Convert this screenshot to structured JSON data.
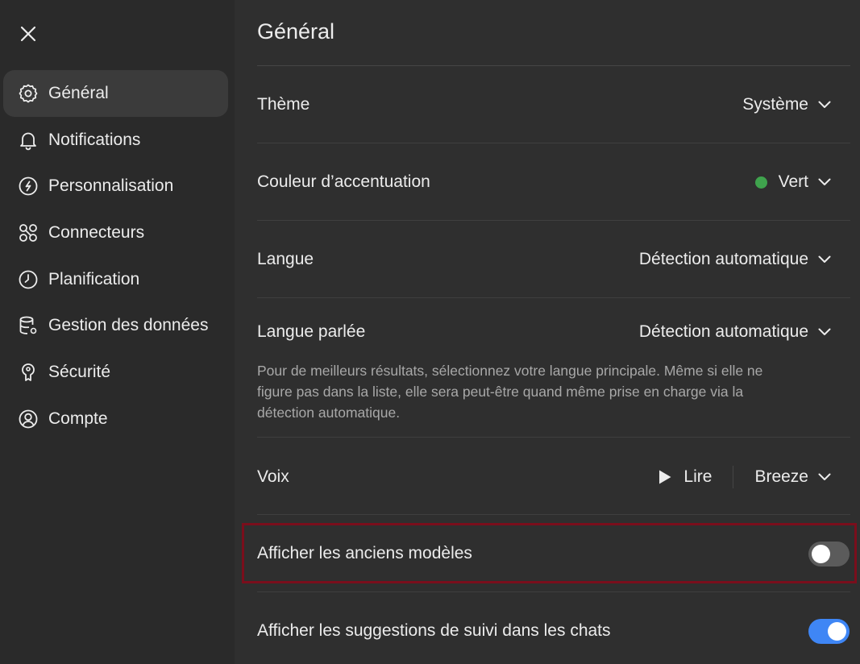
{
  "sidebar": {
    "close_icon": "close-icon",
    "items": [
      {
        "label": "Général",
        "icon": "gear-icon",
        "active": true
      },
      {
        "label": "Notifications",
        "icon": "bell-icon"
      },
      {
        "label": "Personnalisation",
        "icon": "personalization-icon"
      },
      {
        "label": "Connecteurs",
        "icon": "connectors-icon"
      },
      {
        "label": "Planification",
        "icon": "clock-icon"
      },
      {
        "label": "Gestion des données",
        "icon": "database-icon"
      },
      {
        "label": "Sécurité",
        "icon": "key-icon"
      },
      {
        "label": "Compte",
        "icon": "user-circle-icon"
      }
    ]
  },
  "main": {
    "title": "Général",
    "theme": {
      "label": "Thème",
      "value": "Système"
    },
    "accent": {
      "label": "Couleur d’accentuation",
      "value": "Vert",
      "color": "#3fa34d"
    },
    "language": {
      "label": "Langue",
      "value": "Détection automatique"
    },
    "spoken_language": {
      "label": "Langue parlée",
      "value": "Détection automatique",
      "description": "Pour de meilleurs résultats, sélectionnez votre langue principale. Même si elle ne figure pas dans la liste, elle sera peut-être quand même prise en charge via la détection automatique."
    },
    "voice": {
      "label": "Voix",
      "play_label": "Lire",
      "value": "Breeze"
    },
    "legacy_models": {
      "label": "Afficher les anciens modèles",
      "enabled": false
    },
    "follow_up": {
      "label": "Afficher les suggestions de suivi dans les chats",
      "enabled": true
    }
  },
  "colors": {
    "background": "#2f2f2f",
    "sidebar": "#2a2a2a",
    "toggle_on": "#3f86f5",
    "highlight_border": "#7a0e1c"
  }
}
